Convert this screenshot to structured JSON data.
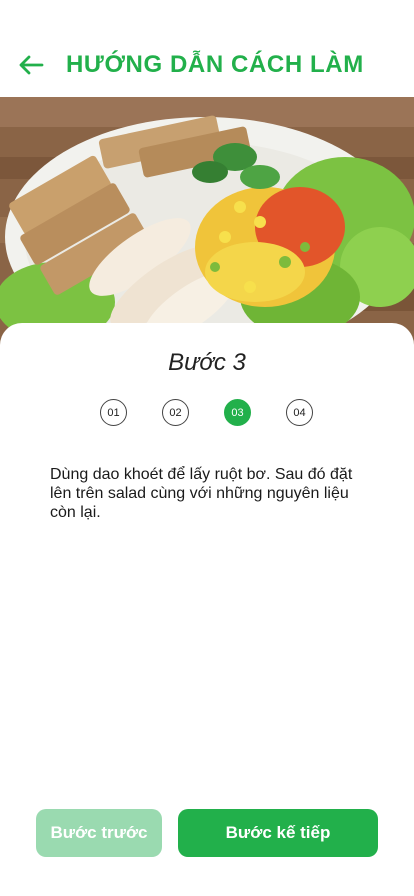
{
  "header": {
    "title": "HƯỚNG DẪN CÁCH LÀM",
    "back_icon": "arrow-left-icon"
  },
  "colors": {
    "accent": "#22b04b",
    "accent_disabled": "#9adab0",
    "text": "#1a1a1a"
  },
  "hero": {
    "image": "salad-photo"
  },
  "step": {
    "title": "Bước 3",
    "indicators": [
      "01",
      "02",
      "03",
      "04"
    ],
    "active_index": 2,
    "description": "Dùng dao khoét để lấy ruột bơ. Sau đó đặt lên trên salad cùng với những nguyên liệu còn lại."
  },
  "footer": {
    "prev_label": "Bước trước",
    "next_label": "Bước kế tiếp"
  }
}
